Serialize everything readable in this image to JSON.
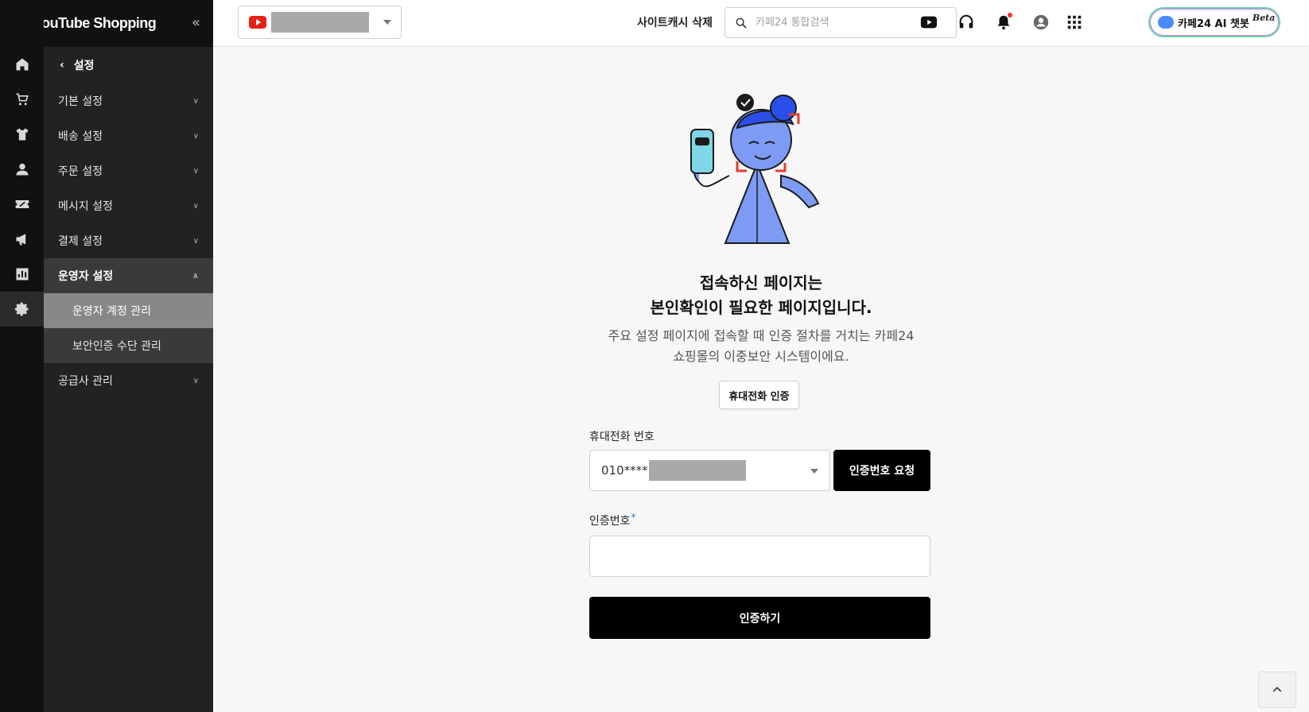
{
  "brand": {
    "name": "YouTube Shopping",
    "icon": "youtube-logo",
    "collapse_glyph": "«"
  },
  "rail": {
    "items": [
      {
        "icon": "home-icon"
      },
      {
        "icon": "cart-icon"
      },
      {
        "icon": "shirt-icon"
      },
      {
        "icon": "person-icon"
      },
      {
        "icon": "coupon-icon"
      },
      {
        "icon": "megaphone-icon"
      },
      {
        "icon": "chart-icon"
      },
      {
        "icon": "gear-icon",
        "active": true
      }
    ]
  },
  "submenu": {
    "back_label": "설정",
    "items": [
      {
        "label": "기본 설정"
      },
      {
        "label": "배송 설정"
      },
      {
        "label": "주문 설정"
      },
      {
        "label": "메시지 설정"
      },
      {
        "label": "결제 설정"
      },
      {
        "label": "운영자 설정",
        "open": true,
        "children": [
          {
            "label": "운영자 계정 관리",
            "active": true
          },
          {
            "label": "보안인증 수단 관리"
          }
        ]
      },
      {
        "label": "공급사 관리"
      }
    ]
  },
  "topbar": {
    "cache_label": "사이트캐시 삭제",
    "search_placeholder": "카페24 통합검색",
    "chatbot_label": "카페24 AI 챗봇",
    "chatbot_badge": "Beta"
  },
  "main": {
    "title_line1": "접속하신 페이지는",
    "title_line2": "본인확인이 필요한 페이지입니다.",
    "desc_line1": "주요 설정 페이지에 접속할 때 인증 절차를 거치는 카페24",
    "desc_line2": "쇼핑몰의 이중보안 시스템이에요.",
    "method_button": "휴대전화 인증",
    "phone_label": "휴대전화 번호",
    "phone_value": "010****",
    "request_button": "인증번호 요청",
    "code_label": "인증번호",
    "code_required_mark": "*",
    "verify_button": "인증하기"
  },
  "colors": {
    "rail_bg": "#111111",
    "submenu_bg": "#222222",
    "active_child": "#888888",
    "primary_btn": "#000000"
  }
}
